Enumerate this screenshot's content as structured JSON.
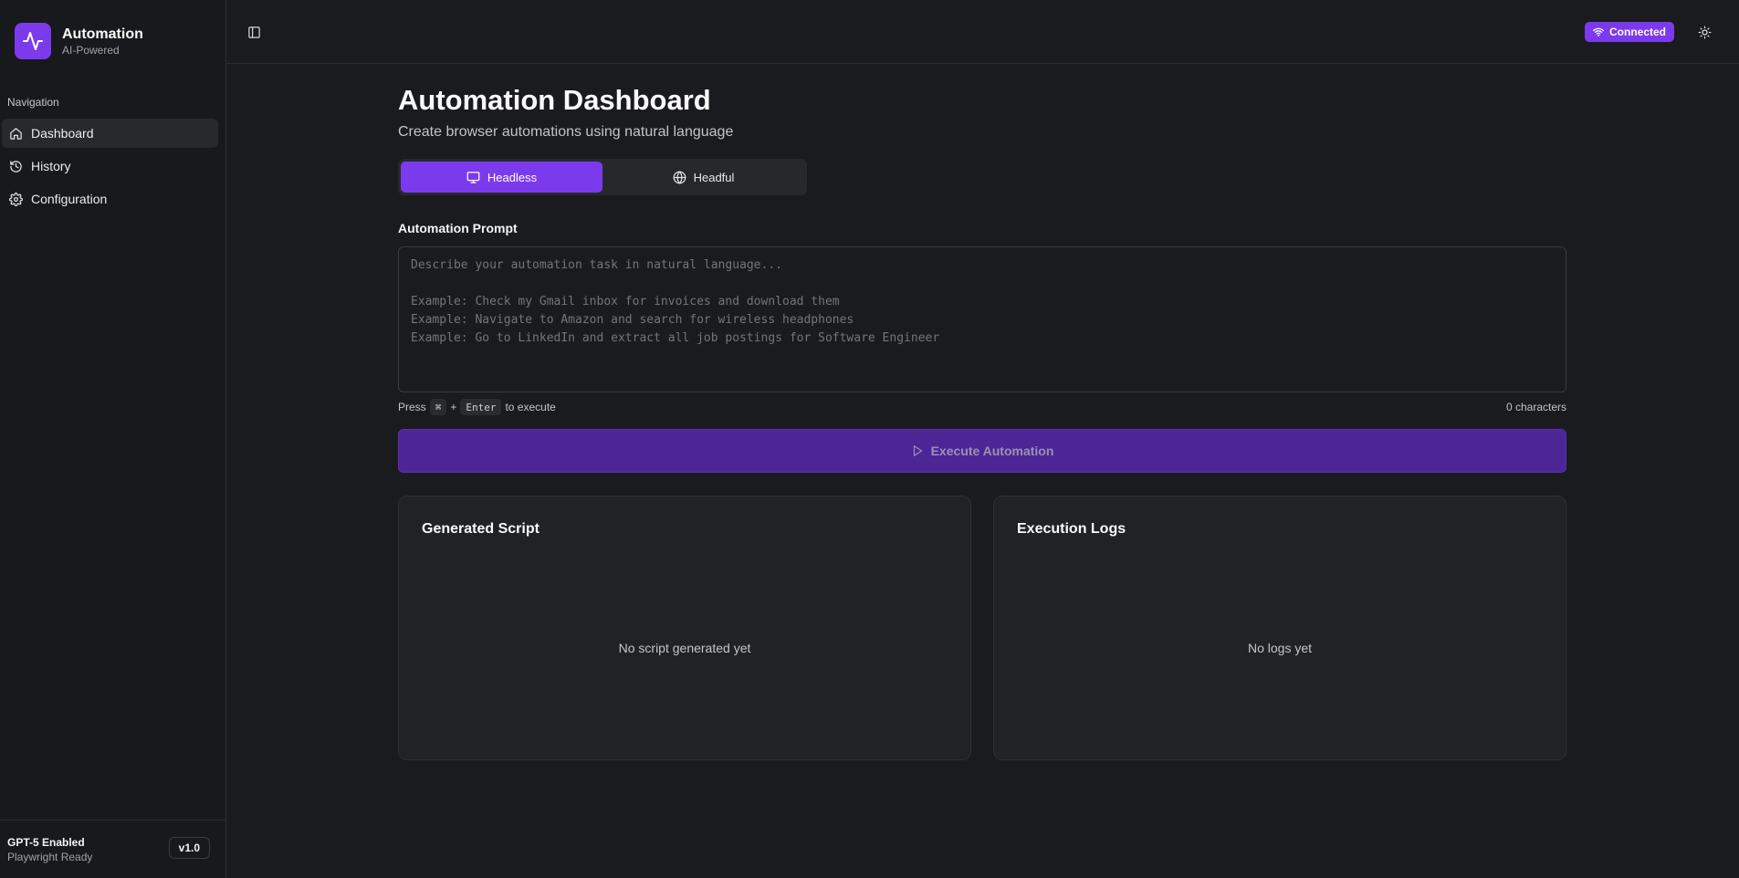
{
  "brand": {
    "title": "Automation",
    "subtitle": "AI-Powered"
  },
  "sidebar": {
    "heading": "Navigation",
    "items": [
      {
        "label": "Dashboard",
        "icon": "home-icon",
        "active": true
      },
      {
        "label": "History",
        "icon": "history-icon",
        "active": false
      },
      {
        "label": "Configuration",
        "icon": "gear-icon",
        "active": false
      }
    ],
    "footer": {
      "title": "GPT-5 Enabled",
      "subtitle": "Playwright Ready",
      "version": "v1.0"
    }
  },
  "header": {
    "status": "Connected",
    "status_icon": "wifi-icon",
    "theme_icon": "sun-icon",
    "toggle_icon": "sidebar-toggle-icon"
  },
  "main": {
    "title": "Automation Dashboard",
    "subtitle": "Create browser automations using natural language",
    "modes": [
      {
        "label": "Headless",
        "icon": "monitor-icon",
        "active": true
      },
      {
        "label": "Headful",
        "icon": "globe-icon",
        "active": false
      }
    ],
    "prompt_label": "Automation Prompt",
    "prompt_placeholder": "Describe your automation task in natural language...\n\nExample: Check my Gmail inbox for invoices and download them\nExample: Navigate to Amazon and search for wireless headphones\nExample: Go to LinkedIn and extract all job postings for Software Engineer",
    "prompt_value": "",
    "hint": {
      "press": "Press",
      "key1": "⌘",
      "plus": "+",
      "key2": "Enter",
      "suffix": "to execute"
    },
    "char_count": "0 characters",
    "execute_label": "Execute Automation",
    "script_panel": {
      "title": "Generated Script",
      "empty": "No script generated yet"
    },
    "logs_panel": {
      "title": "Execution Logs",
      "empty": "No logs yet"
    }
  },
  "colors": {
    "accent": "#7c3aed",
    "background": "#1a1b1e",
    "execute_disabled": "#4c2694"
  }
}
